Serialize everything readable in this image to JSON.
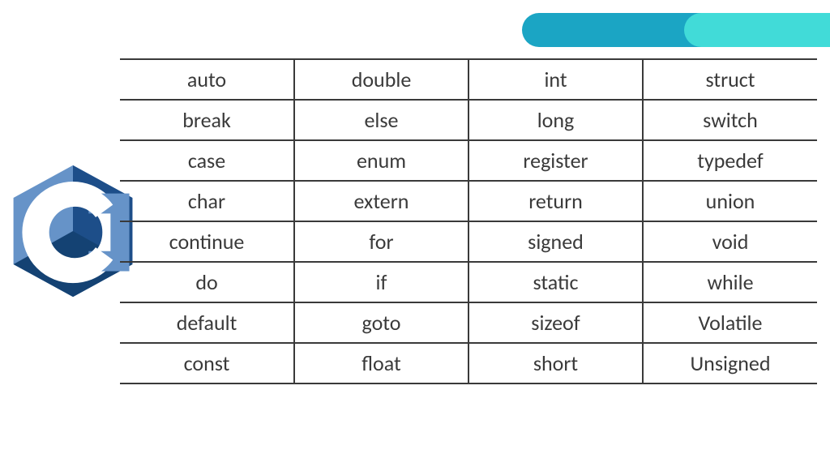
{
  "keywords_table": {
    "columns": 4,
    "rows": [
      [
        "auto",
        "double",
        "int",
        "struct"
      ],
      [
        "break",
        "else",
        "long",
        "switch"
      ],
      [
        "case",
        "enum",
        "register",
        "typedef"
      ],
      [
        "char",
        "extern",
        "return",
        "union"
      ],
      [
        "continue",
        "for",
        "signed",
        "void"
      ],
      [
        "do",
        "if",
        "static",
        "while"
      ],
      [
        "default",
        "goto",
        "sizeof",
        "Volatile"
      ],
      [
        "const",
        "float",
        "short",
        "Unsigned"
      ]
    ]
  },
  "logo": {
    "name": "c-language-logo"
  },
  "decor": {
    "pill_back_color": "#1ba5c4",
    "pill_front_color": "#41dbd8"
  }
}
